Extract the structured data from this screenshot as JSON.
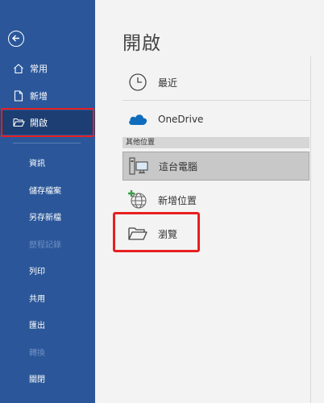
{
  "sidebar": {
    "top_items": [
      {
        "label": "常用",
        "icon": "home-icon"
      },
      {
        "label": "新增",
        "icon": "new-document-icon"
      },
      {
        "label": "開啟",
        "icon": "open-folder-icon",
        "active": true
      }
    ],
    "sub_items": [
      {
        "label": "資訊",
        "enabled": true
      },
      {
        "label": "儲存檔案",
        "enabled": true
      },
      {
        "label": "另存新檔",
        "enabled": true
      },
      {
        "label": "歷程記錄",
        "enabled": false
      },
      {
        "label": "列印",
        "enabled": true
      },
      {
        "label": "共用",
        "enabled": true
      },
      {
        "label": "匯出",
        "enabled": true
      },
      {
        "label": "轉換",
        "enabled": false
      },
      {
        "label": "關閉",
        "enabled": true
      }
    ]
  },
  "main": {
    "title": "開啟",
    "recent_label": "最近",
    "onedrive_label": "OneDrive",
    "other_locations_header": "其他位置",
    "this_pc_label": "這台電腦",
    "add_location_label": "新增位置",
    "browse_label": "瀏覽"
  },
  "colors": {
    "sidebar_bg": "#2b579a",
    "active_bg": "#1c3e72",
    "highlight": "#e81f1f",
    "onedrive": "#0f6cbd"
  }
}
